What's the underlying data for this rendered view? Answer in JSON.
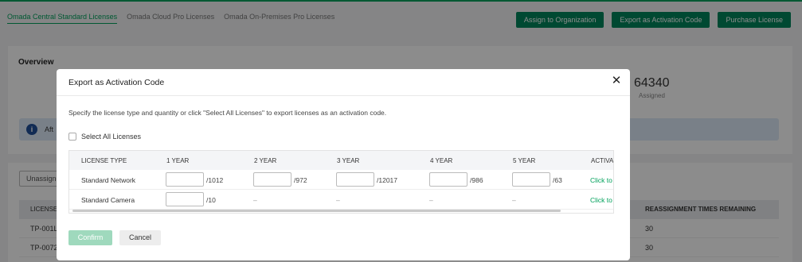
{
  "page": {
    "tabs": [
      {
        "label": "Omada Central Standard Licenses",
        "active": true
      },
      {
        "label": "Omada Cloud Pro Licenses",
        "active": false
      },
      {
        "label": "Omada On-Premises Pro Licenses",
        "active": false
      }
    ],
    "actions": {
      "assign": "Assign to Organization",
      "export": "Export as Activation Code",
      "purchase": "Purchase License"
    },
    "overview": {
      "title": "Overview",
      "assigned_value": "64340",
      "assigned_label": "Assigned",
      "info_text": "Aft"
    },
    "list": {
      "unassigned_button": "Unassigne",
      "col_license": "LICENSE",
      "col_reassign": "REASSIGNMENT TIMES REMAINING",
      "rows": [
        {
          "license": "TP-001L",
          "remaining": "30"
        },
        {
          "license": "TP-0072",
          "remaining": "30"
        }
      ]
    }
  },
  "modal": {
    "title": "Export as Activation Code",
    "close_icon": "close-icon",
    "description": "Specify the license type and quantity or click \"Select All Licenses\" to export licenses as an activation code.",
    "select_all_label": "Select All Licenses",
    "select_all_checked": false,
    "table": {
      "headers": [
        "LICENSE TYPE",
        "1 YEAR",
        "2 YEAR",
        "3 YEAR",
        "4 YEAR",
        "5 YEAR",
        "ACTIVAT"
      ],
      "rows": [
        {
          "type": "Standard Network",
          "limits": [
            "/1012",
            "/972",
            "/12017",
            "/986",
            "/63"
          ],
          "action": "Click to"
        },
        {
          "type": "Standard Camera",
          "limits": [
            "/10",
            "–",
            "–",
            "–",
            "–"
          ],
          "action": "Click to"
        }
      ]
    },
    "confirm_label": "Confirm",
    "cancel_label": "Cancel"
  },
  "colors": {
    "brand_green": "#00a15b",
    "button_green": "#00855b",
    "confirm_disabled": "#9fd9bd"
  }
}
